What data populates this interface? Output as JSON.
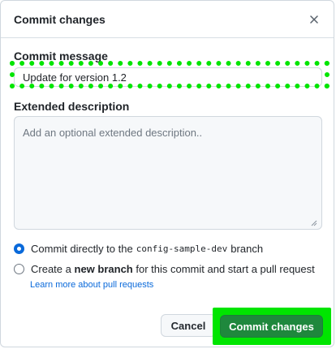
{
  "dialog": {
    "title": "Commit changes",
    "close_icon": "close-icon"
  },
  "commit_message": {
    "label": "Commit message",
    "value": "Update for version 1.2"
  },
  "extended_description": {
    "label": "Extended description",
    "placeholder": "Add an optional extended description.."
  },
  "options": {
    "direct": {
      "prefix": "Commit directly to the",
      "branch": "config-sample-dev",
      "suffix": "branch",
      "checked": true
    },
    "new_branch": {
      "prefix": "Create a",
      "bold": "new branch",
      "suffix": "for this commit and start a pull request",
      "checked": false
    },
    "learn_more": "Learn more about pull requests"
  },
  "buttons": {
    "cancel": "Cancel",
    "commit": "Commit changes"
  },
  "colors": {
    "primary_button": "#1f883d",
    "radio_checked": "#0969da",
    "highlight": "#00e500",
    "link": "#0969da"
  }
}
